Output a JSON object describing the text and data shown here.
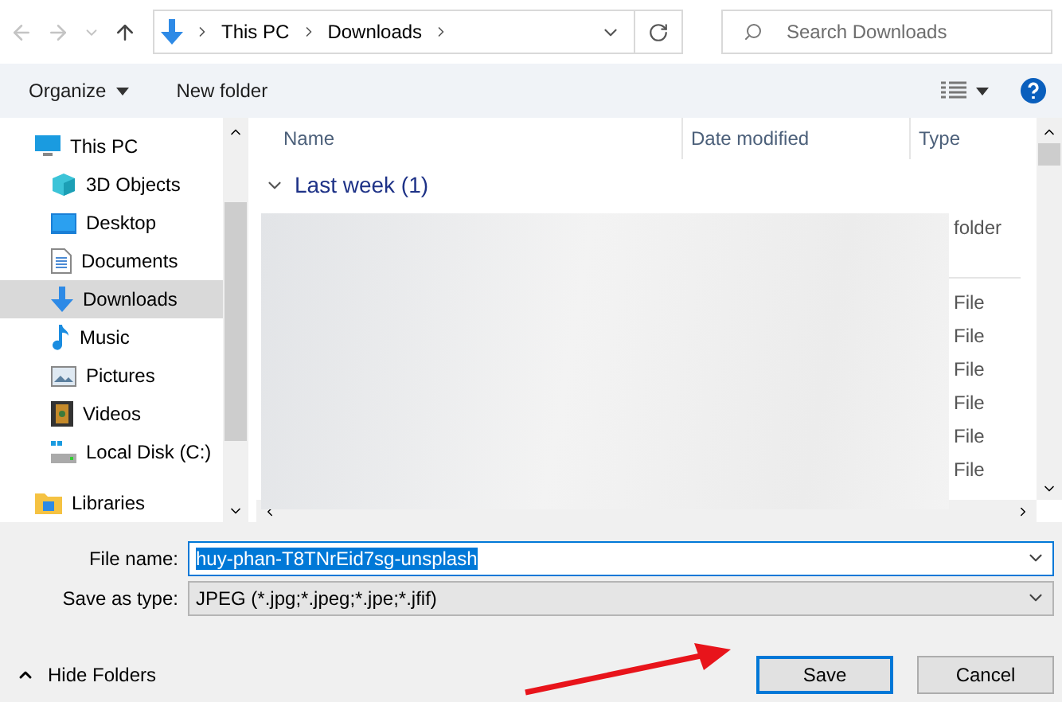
{
  "nav": {
    "breadcrumb": [
      "This PC",
      "Downloads"
    ],
    "search": {
      "placeholder": "Search Downloads"
    }
  },
  "toolbar": {
    "organize": "Organize",
    "new_folder": "New folder"
  },
  "sidebar": {
    "items": [
      {
        "label": "This PC",
        "selected": false,
        "children": [
          {
            "label": "3D Objects",
            "selected": false
          },
          {
            "label": "Desktop",
            "selected": false
          },
          {
            "label": "Documents",
            "selected": false
          },
          {
            "label": "Downloads",
            "selected": true
          },
          {
            "label": "Music",
            "selected": false
          },
          {
            "label": "Pictures",
            "selected": false
          },
          {
            "label": "Videos",
            "selected": false
          },
          {
            "label": "Local Disk (C:)",
            "selected": false
          }
        ]
      },
      {
        "label": "Libraries",
        "selected": false
      }
    ]
  },
  "file_list": {
    "columns": [
      "Name",
      "Date modified",
      "Type"
    ],
    "group": {
      "label": "Last week (1)",
      "expanded": true
    },
    "groups": [
      {
        "type_cells": [
          "folder"
        ]
      },
      {
        "type_cells": [
          "File",
          "File",
          "File",
          "File",
          "File",
          "File"
        ]
      }
    ]
  },
  "form": {
    "file_name": {
      "label": "File name:",
      "value": "huy-phan-T8TNrEid7sg-unsplash"
    },
    "save_type": {
      "label": "Save as type:",
      "value": "JPEG (*.jpg;*.jpeg;*.jpe;*.jfif)"
    }
  },
  "footer": {
    "hide_folders": "Hide Folders",
    "buttons": [
      {
        "label": "Save",
        "default": true
      },
      {
        "label": "Cancel",
        "default": false
      }
    ]
  }
}
